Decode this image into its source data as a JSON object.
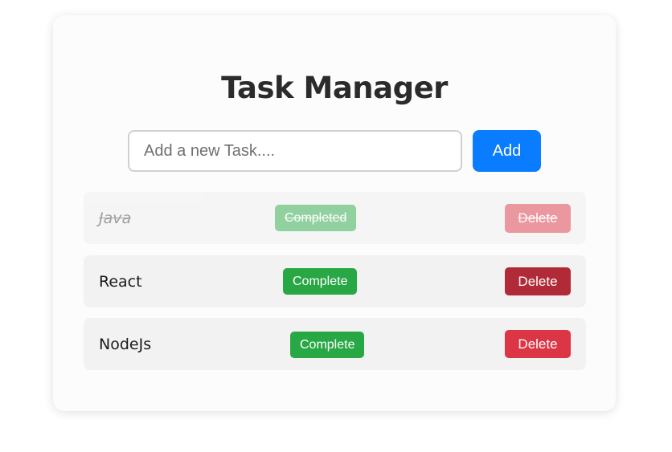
{
  "app": {
    "title": "Task Manager"
  },
  "input": {
    "placeholder": "Add a new Task....",
    "value": ""
  },
  "add_button": {
    "label": "Add"
  },
  "tasks": [
    {
      "name": "Java",
      "completed": true,
      "complete_label": "Completed",
      "delete_label": "Delete"
    },
    {
      "name": "React",
      "completed": false,
      "complete_label": "Complete",
      "delete_label": "Delete"
    },
    {
      "name": "NodeJs",
      "completed": false,
      "complete_label": "Complete",
      "delete_label": "Delete"
    }
  ],
  "colors": {
    "primary": "#0a7cff",
    "success": "#28a745",
    "danger": "#dc3545",
    "danger_hover": "#b02a37",
    "text_dark": "#2b2b2b",
    "row_background": "#f2f2f2"
  }
}
